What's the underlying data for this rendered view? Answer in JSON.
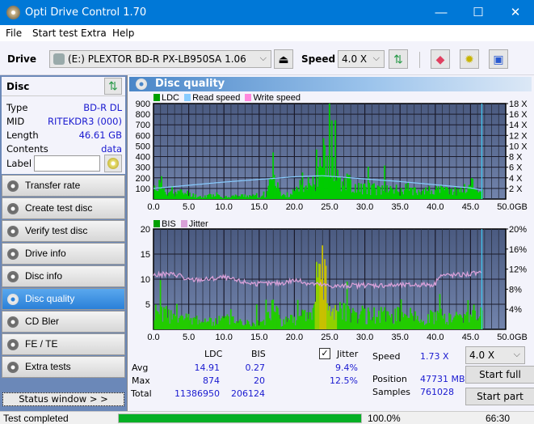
{
  "window": {
    "title": "Opti Drive Control 1.70",
    "minimize": "—",
    "maximize": "☐",
    "close": "✕"
  },
  "menu": [
    "File",
    "Start test",
    "Extra",
    "Help"
  ],
  "toolbar": {
    "drive_label": "Drive",
    "drive_value": "(E:)  PLEXTOR BD-R  PX-LB950SA 1.06",
    "speed_label": "Speed",
    "speed_value": "4.0 X",
    "icons": [
      "eject-icon",
      "refresh-icon",
      "erase-icon",
      "settings-icon",
      "save-icon"
    ]
  },
  "disc": {
    "header": "Disc",
    "fields": [
      {
        "label": "Type",
        "value": "BD-R DL"
      },
      {
        "label": "MID",
        "value": "RITEKDR3 (000)"
      },
      {
        "label": "Length",
        "value": "46.61 GB"
      },
      {
        "label": "Contents",
        "value": "data"
      }
    ],
    "label_field": "Label",
    "label_value": ""
  },
  "nav": [
    {
      "label": "Transfer rate",
      "active": false
    },
    {
      "label": "Create test disc",
      "active": false
    },
    {
      "label": "Verify test disc",
      "active": false
    },
    {
      "label": "Drive info",
      "active": false
    },
    {
      "label": "Disc info",
      "active": false
    },
    {
      "label": "Disc quality",
      "active": true
    },
    {
      "label": "CD Bler",
      "active": false
    },
    {
      "label": "FE / TE",
      "active": false
    },
    {
      "label": "Extra tests",
      "active": false
    }
  ],
  "status_window_btn": "Status window > >",
  "panel_title": "Disc quality",
  "chart_data": [
    {
      "type": "bar",
      "title": "LDC / Read speed",
      "legend": [
        {
          "name": "LDC",
          "color": "#00a000"
        },
        {
          "name": "Read speed",
          "color": "#88ccff"
        },
        {
          "name": "Write speed",
          "color": "#ff88dd"
        }
      ],
      "xlabel": "GB",
      "xlim": [
        0,
        50
      ],
      "xticks": [
        "0.0",
        "5.0",
        "10.0",
        "15.0",
        "20.0",
        "25.0",
        "30.0",
        "35.0",
        "40.0",
        "45.0",
        "50.0"
      ],
      "ylim": [
        0,
        900
      ],
      "yticks": [
        "100",
        "200",
        "300",
        "400",
        "500",
        "600",
        "700",
        "800",
        "900"
      ],
      "y2ticks": [
        "2 X",
        "4 X",
        "6 X",
        "8 X",
        "10 X",
        "12 X",
        "14 X",
        "16 X",
        "18 X"
      ],
      "y2lim": [
        0,
        18
      ],
      "end_gb": 46.61,
      "series": [
        {
          "name": "LDC",
          "x": [
            0,
            1,
            2,
            3,
            4,
            5,
            6,
            7,
            8,
            9,
            10,
            11,
            12,
            13,
            14,
            15,
            16,
            17,
            18,
            19,
            20,
            21,
            22,
            23,
            23.5,
            24,
            24.5,
            25,
            26,
            27,
            28,
            29,
            30,
            31,
            32,
            33,
            34,
            35,
            36,
            37,
            38,
            39,
            40,
            41,
            42,
            43,
            44,
            45,
            46,
            46.6
          ],
          "values": [
            150,
            200,
            90,
            80,
            90,
            70,
            40,
            30,
            60,
            40,
            30,
            40,
            40,
            50,
            40,
            30,
            50,
            450,
            40,
            60,
            100,
            120,
            150,
            300,
            600,
            874,
            580,
            400,
            300,
            250,
            200,
            150,
            150,
            140,
            120,
            150,
            130,
            120,
            140,
            130,
            120,
            110,
            120,
            110,
            120,
            110,
            130,
            200,
            150,
            80
          ]
        },
        {
          "name": "Read speed",
          "x": [
            0,
            5,
            10,
            15,
            20,
            24,
            25,
            30,
            35,
            40,
            45,
            46.6
          ],
          "values": [
            2.0,
            2.6,
            3.2,
            3.7,
            4.2,
            4.4,
            4.3,
            3.8,
            3.3,
            2.7,
            2.1,
            1.73
          ]
        }
      ]
    },
    {
      "type": "bar",
      "title": "BIS / Jitter",
      "legend": [
        {
          "name": "BIS",
          "color": "#00a000"
        },
        {
          "name": "Jitter",
          "color": "#d8a0d8"
        }
      ],
      "xlabel": "GB",
      "xlim": [
        0,
        50
      ],
      "xticks": [
        "0.0",
        "5.0",
        "10.0",
        "15.0",
        "20.0",
        "25.0",
        "30.0",
        "35.0",
        "40.0",
        "45.0",
        "50.0"
      ],
      "ylim": [
        0,
        20
      ],
      "yticks": [
        "5",
        "10",
        "15",
        "20"
      ],
      "y2ticks": [
        "4%",
        "8%",
        "12%",
        "16%",
        "20%"
      ],
      "y2lim": [
        0,
        20
      ],
      "end_gb": 46.61,
      "series": [
        {
          "name": "BIS",
          "x": [
            0,
            2,
            4,
            6,
            8,
            10,
            12,
            14,
            16,
            17,
            18,
            20,
            22,
            23,
            23.7,
            24,
            25,
            26,
            28,
            30,
            32,
            34,
            36,
            38,
            40,
            42,
            44,
            45,
            46.6
          ],
          "values": [
            5,
            4,
            3,
            3,
            2,
            3,
            2,
            2,
            3,
            7,
            2,
            3,
            4,
            6,
            20,
            14,
            8,
            6,
            5,
            4,
            4,
            4,
            4,
            3,
            4,
            3,
            4,
            6,
            4
          ]
        },
        {
          "name": "Jitter",
          "x": [
            0,
            2,
            4,
            4.5,
            8,
            10,
            12,
            15,
            18,
            20,
            22,
            24,
            26,
            30,
            35,
            40,
            40.5,
            43,
            46.6
          ],
          "values": [
            10.8,
            11.0,
            10.8,
            9.8,
            10.0,
            10.4,
            9.6,
            9.0,
            9.2,
            9.8,
            9.2,
            8.8,
            8.6,
            8.8,
            8.8,
            9.0,
            10.8,
            10.8,
            11.2
          ]
        }
      ]
    }
  ],
  "stats": {
    "col_ldc": "LDC",
    "col_bis": "BIS",
    "col_jitter": "Jitter",
    "jitter_checked": true,
    "rows": [
      {
        "label": "Avg",
        "ldc": "14.91",
        "bis": "0.27",
        "jitter": "9.4%"
      },
      {
        "label": "Max",
        "ldc": "874",
        "bis": "20",
        "jitter": "12.5%"
      },
      {
        "label": "Total",
        "ldc": "11386950",
        "bis": "206124",
        "jitter": ""
      }
    ],
    "speed_label": "Speed",
    "speed_value": "1.73 X",
    "position_label": "Position",
    "position_value": "47731 MB",
    "samples_label": "Samples",
    "samples_value": "761028",
    "speed_select": "4.0 X",
    "start_full": "Start full",
    "start_part": "Start part"
  },
  "statusbar": {
    "text": "Test completed",
    "progress_percent": 100,
    "progress_label": "100.0%",
    "elapsed": "66:30"
  },
  "colors": {
    "accent": "#0078d7",
    "link_blue": "#1a1ad0",
    "progress": "#06b025",
    "chart_bg_top": "#4a5a80",
    "chart_bg_bottom": "#6f82aa"
  }
}
